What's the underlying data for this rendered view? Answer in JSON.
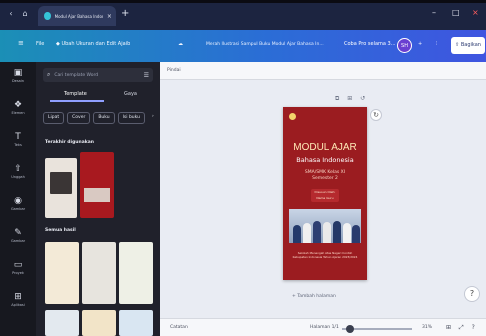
{
  "browser": {
    "tab_title": "Modul Ajar Bahasa Indonesia",
    "new_tab_glyph": "+",
    "controls": [
      "‹",
      "⌂"
    ],
    "window_buttons": [
      "–",
      "□",
      "×"
    ]
  },
  "topbar": {
    "menu_icon": "≡",
    "file_label": "File",
    "resize_label": "Ubah Ukuran dan Edit Ajaib",
    "doc_title": "Merah Ilustrasi Sampul Buku Modul Ajar Bahasa In...",
    "pro_label": "Coba Pro selama 3...",
    "avatar_initials": "SH",
    "share_label": "Bagikan"
  },
  "rail": {
    "items": [
      {
        "icon": "▣",
        "label": "Desain"
      },
      {
        "icon": "❖",
        "label": "Elemen"
      },
      {
        "icon": "T",
        "label": "Teks"
      },
      {
        "icon": "⇧",
        "label": "Unggah"
      },
      {
        "icon": "◉",
        "label": "Gambar"
      },
      {
        "icon": "✎",
        "label": "Gambar"
      },
      {
        "icon": "▭",
        "label": "Proyek"
      },
      {
        "icon": "⊞",
        "label": "Aplikasi"
      }
    ]
  },
  "panel": {
    "search_placeholder": "Cari template Word",
    "tabs": [
      "Template",
      "Gaya"
    ],
    "chips": [
      "Lipat",
      "Cover",
      "Buku",
      "Isi buku",
      "›"
    ],
    "section_recommended": "Terakhir digunakan",
    "section_all": "Semua hasil"
  },
  "workspace": {
    "page_label": "Pindai",
    "page_tools": "⧉ ⊞ ↺",
    "cover": {
      "title": "MODUL AJAR",
      "subtitle": "Bahasa Indonesia",
      "grade": "SMA/SMK Kelas XI",
      "semester": "Semester 2",
      "author": "Disusun Oleh: Nama Guru",
      "footer": "Sekolah Menengah Atas Negeri Contoh Kabupaten Indonesia Tahun Ajaran 2023/2024"
    },
    "refresh_icon": "↻",
    "add_page": "+ Tambah halaman",
    "fab": "?"
  },
  "bottombar": {
    "notes": "Catatan",
    "page_info": "Halaman 1/1",
    "zoom": "31%",
    "icons": "⊞ ⤢ ?"
  },
  "colors": {
    "topbar_start": "#1b8fb6",
    "topbar_end": "#3f55e0",
    "cover_red": "#9b1c20",
    "panel_bg": "#20212b"
  }
}
